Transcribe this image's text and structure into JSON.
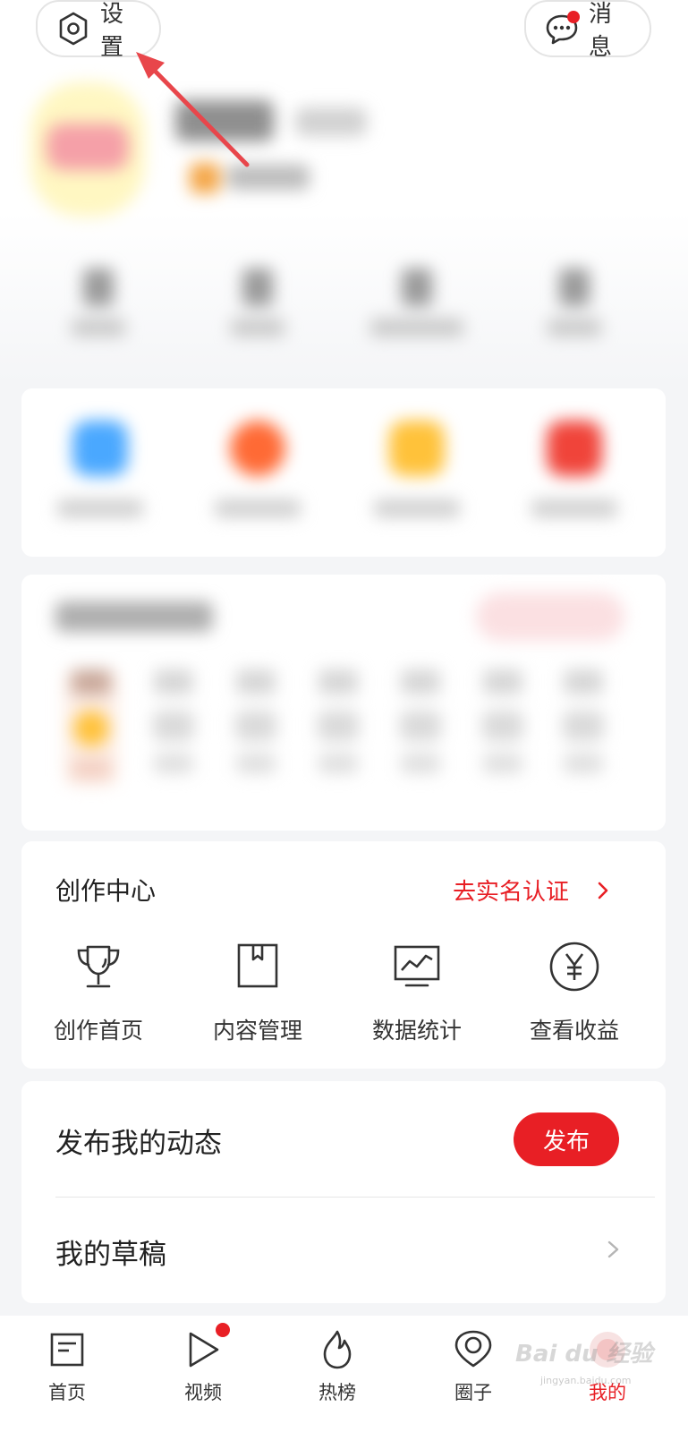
{
  "header": {
    "settings_label": "设置",
    "messages_label": "消息",
    "messages_has_unread": true
  },
  "creation_center": {
    "title": "创作中心",
    "verify_link": "去实名认证",
    "tools": [
      {
        "label": "创作首页",
        "icon": "trophy-icon"
      },
      {
        "label": "内容管理",
        "icon": "bookmark-box-icon"
      },
      {
        "label": "数据统计",
        "icon": "chart-monitor-icon"
      },
      {
        "label": "查看收益",
        "icon": "yuan-circle-icon"
      }
    ]
  },
  "publish": {
    "title": "发布我的动态",
    "button_label": "发布"
  },
  "drafts": {
    "label": "我的草稿"
  },
  "bottom_nav": {
    "items": [
      {
        "label": "首页",
        "icon": "home-news-icon"
      },
      {
        "label": "视频",
        "icon": "play-icon"
      },
      {
        "label": "热榜",
        "icon": "flame-icon"
      },
      {
        "label": "圈子",
        "icon": "location-pin-icon"
      },
      {
        "label": "我的",
        "icon": "avatar-icon"
      }
    ],
    "active": "我的"
  },
  "watermark": {
    "text": "Bai du 经验",
    "url": "jingyan.baidu.com"
  },
  "colors": {
    "accent": "#e81f25",
    "background": "#f4f5f7",
    "card": "#ffffff"
  }
}
